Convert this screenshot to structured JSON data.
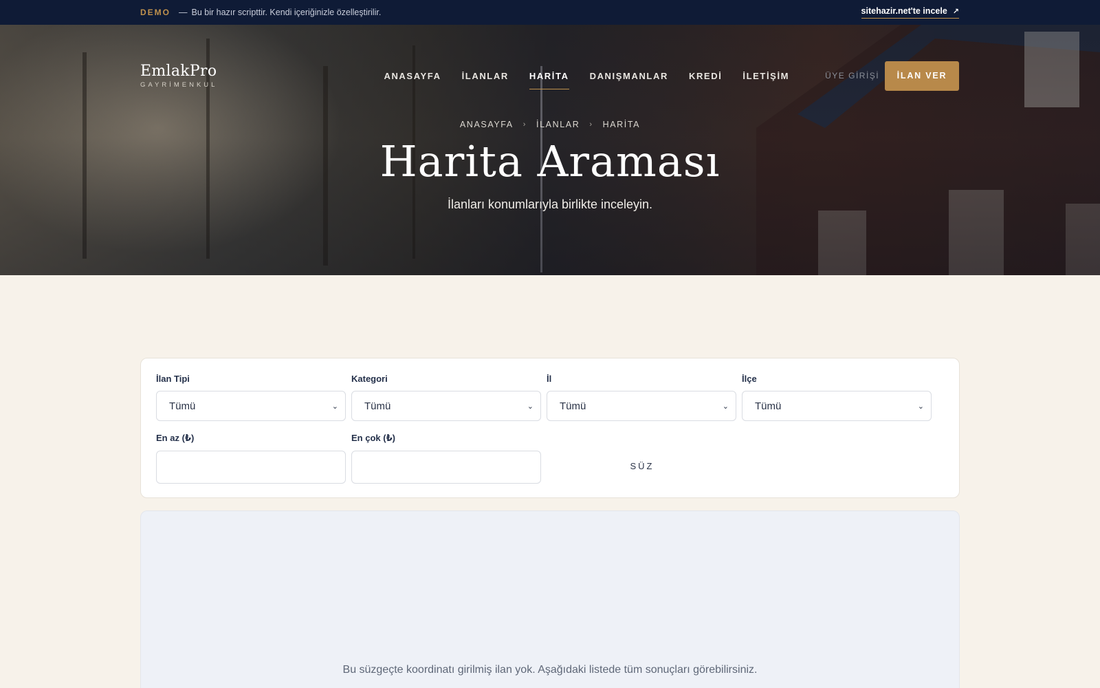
{
  "demo_bar": {
    "tag": "DEMO",
    "dash": "—",
    "text": "Bu bir hazır scripttir. Kendi içeriğinizle özelleştirilir.",
    "link_label": "sitehazir.net'te incele",
    "link_icon": "external-arrow-icon"
  },
  "header": {
    "logo_name": "EmlakPro",
    "logo_sub": "GAYRİMENKUL",
    "nav": [
      {
        "label": "ANASAYFA",
        "active": false
      },
      {
        "label": "İLANLAR",
        "active": false
      },
      {
        "label": "HARİTA",
        "active": true
      },
      {
        "label": "DANIŞMANLAR",
        "active": false
      },
      {
        "label": "KREDİ",
        "active": false
      },
      {
        "label": "İLETİŞİM",
        "active": false
      }
    ],
    "login": "ÜYE GİRİŞİ",
    "cta": "İLAN VER"
  },
  "hero": {
    "breadcrumbs": [
      "ANASAYFA",
      "İLANLAR",
      "HARİTA"
    ],
    "crumb_sep_icon": "chevron-right-icon",
    "title": "Harita Araması",
    "subtitle": "İlanları konumlarıyla birlikte inceleyin."
  },
  "filters": {
    "listing_type": {
      "label": "İlan Tipi",
      "value": "Tümü"
    },
    "category": {
      "label": "Kategori",
      "value": "Tümü"
    },
    "province": {
      "label": "İl",
      "value": "Tümü"
    },
    "district": {
      "label": "İlçe",
      "value": "Tümü"
    },
    "min_price": {
      "label": "En az (₺)",
      "value": ""
    },
    "max_price": {
      "label": "En çok (₺)",
      "value": ""
    },
    "submit": "SÜZ"
  },
  "map": {
    "empty_message": "Bu süzgeçte koordinatı girilmiş ilan yok. Aşağıdaki listede tüm sonuçları görebilirsiniz."
  },
  "colors": {
    "accent": "#b8894a",
    "demo_bar": "#0f1b36",
    "page_bg": "#f7f2ea",
    "map_bg": "#eef1f7"
  }
}
